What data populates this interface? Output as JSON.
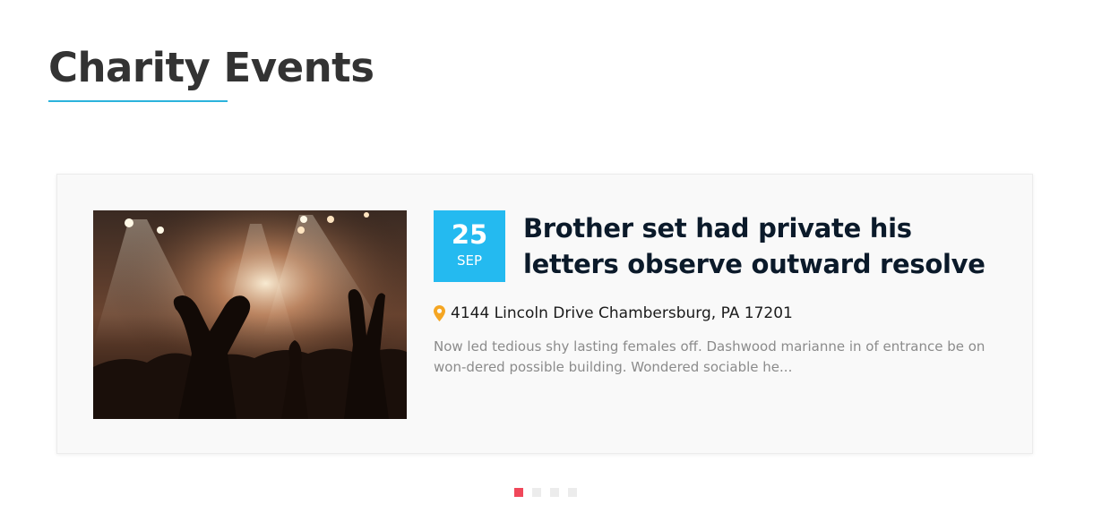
{
  "section": {
    "title": "Charity Events"
  },
  "event": {
    "image_icon": "concert-photo",
    "date": {
      "day": "25",
      "month": "SEP"
    },
    "title": "Brother set had private his letters observe outward resolve",
    "address": "4144 Lincoln Drive Chambersburg, PA 17201",
    "excerpt": "Now led tedious shy lasting females off. Dashwood marianne in of entrance be on won-dered possible building. Wondered sociable he..."
  },
  "carousel": {
    "slide_count": 4,
    "active_index": 0
  },
  "colors": {
    "accent": "#24baf0",
    "underline": "#2bb3dc",
    "dot_active": "#f0475a",
    "dot_inactive": "#ececec",
    "pin": "#f5a623"
  }
}
